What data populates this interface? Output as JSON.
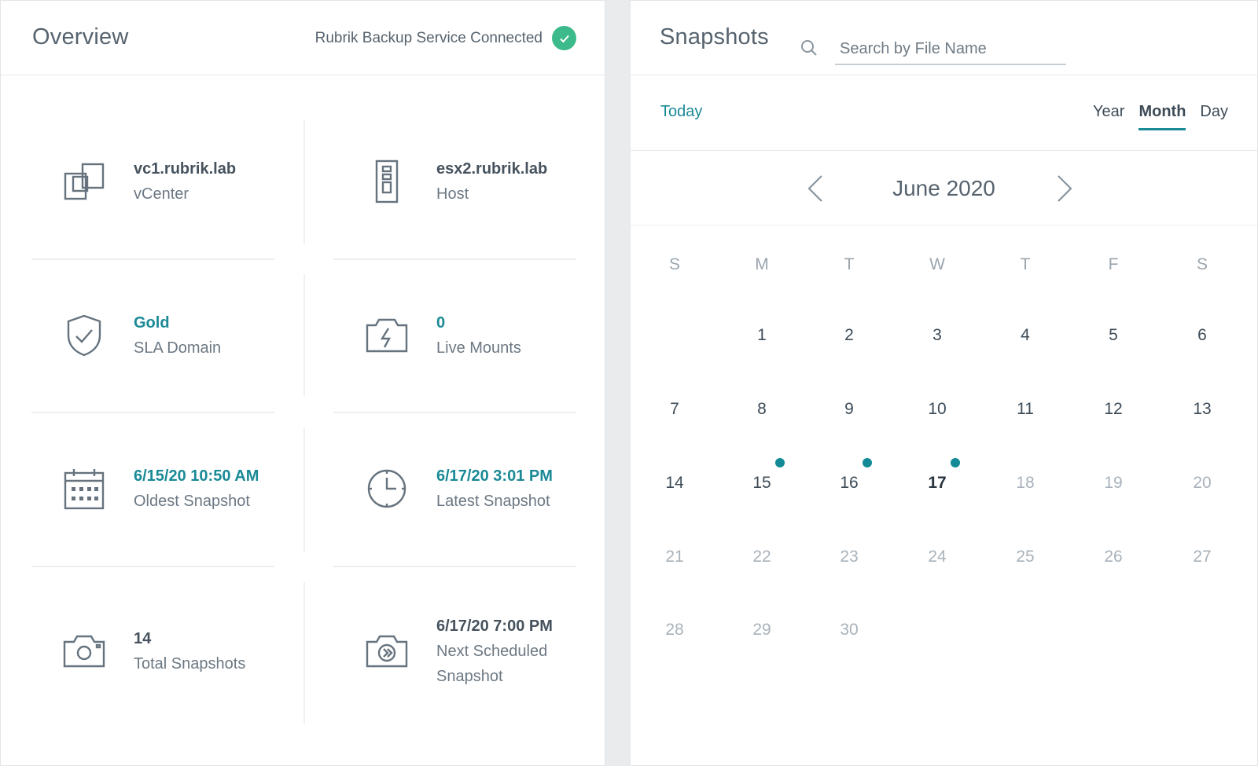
{
  "overview": {
    "title": "Overview",
    "connection_status": "Rubrik Backup Service Connected",
    "connection_color": "#3dba8c",
    "tiles": [
      {
        "icon": "vcenter-icon",
        "value": "vc1.rubrik.lab",
        "label": "vCenter"
      },
      {
        "icon": "host-icon",
        "value": "esx2.rubrik.lab",
        "label": "Host"
      },
      {
        "icon": "shield-check-icon",
        "value": "Gold",
        "label": "SLA Domain"
      },
      {
        "icon": "live-mount-icon",
        "value": "0",
        "label": "Live Mounts"
      },
      {
        "icon": "calendar-icon",
        "value": "6/15/20 10:50 AM",
        "label": "Oldest Snapshot"
      },
      {
        "icon": "clock-icon",
        "value": "6/17/20 3:01 PM",
        "label": "Latest Snapshot"
      },
      {
        "icon": "camera-icon",
        "value": "14",
        "label": "Total Snapshots"
      },
      {
        "icon": "scheduled-camera-icon",
        "value": "6/17/20 7:00 PM",
        "label": "Next Scheduled Snapshot"
      }
    ]
  },
  "snapshots": {
    "title": "Snapshots",
    "search_placeholder": "Search by File Name",
    "today_label": "Today",
    "view_tabs": [
      "Year",
      "Month",
      "Day"
    ],
    "active_view": "Month",
    "month_label": "June 2020",
    "weekdays": [
      "S",
      "M",
      "T",
      "W",
      "T",
      "F",
      "S"
    ],
    "first_weekday_index": 1,
    "days_in_month": 30,
    "current_day": 17,
    "snapshot_days": [
      15,
      16,
      17
    ],
    "accent_color": "#1a8a96"
  }
}
